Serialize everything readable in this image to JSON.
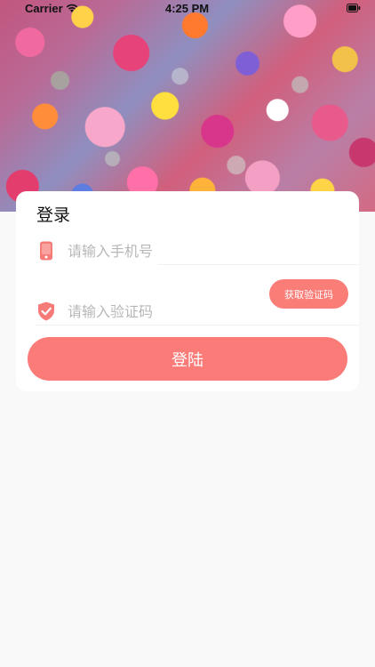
{
  "status_bar": {
    "carrier": "Carrier",
    "time": "4:25 PM"
  },
  "hero": {
    "image": "floral-wall"
  },
  "login_card": {
    "title": "登录",
    "phone_field": {
      "icon": "mobile-phone-icon",
      "placeholder": "请输入手机号",
      "value": ""
    },
    "code_field": {
      "icon": "shield-check-icon",
      "placeholder": "请输入验证码",
      "value": ""
    },
    "get_code_button_label": "获取验证码",
    "login_button_label": "登陆"
  },
  "colors": {
    "accent": "#fa7b77",
    "page_background": "#f9f9f9",
    "card_background": "#ffffff",
    "placeholder_text": "#b7b7b7"
  }
}
